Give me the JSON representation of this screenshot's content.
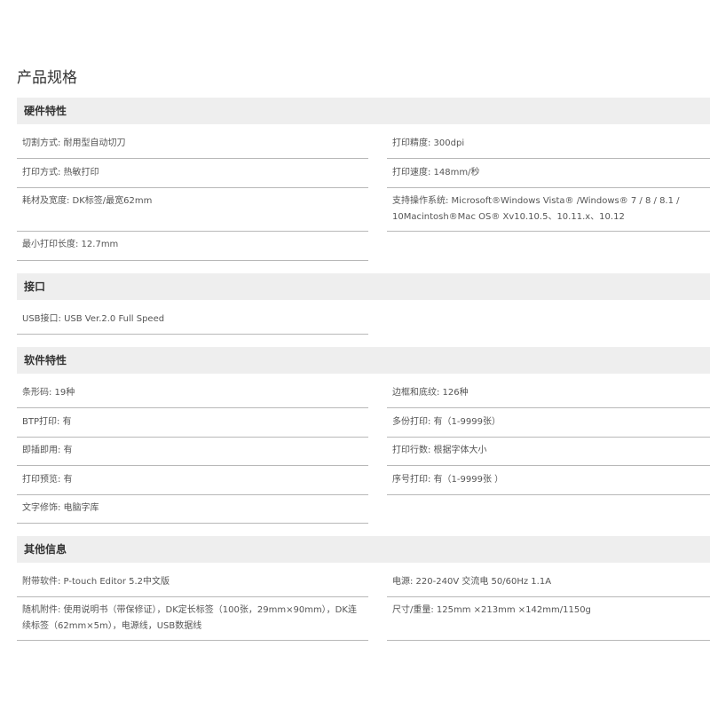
{
  "page_title": "产品规格",
  "sections": {
    "hardware": {
      "title": "硬件特性",
      "cut_mode": "切割方式: 耐用型自动切刀",
      "print_resolution": "打印精度: 300dpi",
      "print_method": "打印方式: 热敏打印",
      "print_speed": "打印速度: 148mm/秒",
      "media_width": "耗材及宽度: DK标签/最宽62mm",
      "os_support": "支持操作系统: Microsoft®Windows Vista® /Windows® 7 / 8 / 8.1 / 10Macintosh®Mac OS® Xv10.10.5、10.11.x、10.12",
      "min_length": "最小打印长度: 12.7mm"
    },
    "interface": {
      "title": "接口",
      "usb": "USB接口: USB Ver.2.0 Full Speed"
    },
    "software": {
      "title": "软件特性",
      "barcode": "条形码: 19种",
      "frames": "边框和底纹: 126种",
      "btp": "BTP打印: 有",
      "multi_copy": "多份打印: 有（1-9999张）",
      "plug_and_print": "即插即用: 有",
      "print_lines": "打印行数: 根据字体大小",
      "preview": "打印预览: 有",
      "numbering": "序号打印: 有（1-9999张 ）",
      "text_decoration": "文字修饰: 电脑字库"
    },
    "other": {
      "title": "其他信息",
      "bundled_software": "附带软件: P-touch Editor 5.2中文版",
      "power": "电源: 220-240V 交流电 50/60Hz 1.1A",
      "accessories": "随机附件: 使用说明书（带保修证），DK定长标签（100张，29mm×90mm），DK连续标签（62mm×5m），电源线，USB数据线",
      "dimensions": "尺寸/重量: 125mm ×213mm ×142mm/1150g"
    }
  }
}
